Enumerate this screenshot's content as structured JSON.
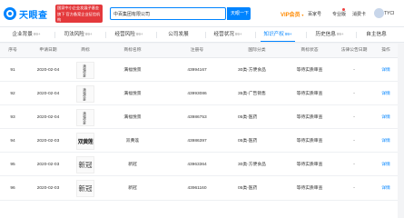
{
  "header": {
    "logo_text": "天眼查",
    "promo_text": "国家中小企业发展子基金旗下 官方备案企业征信机构",
    "search_value": "中百集团有限公司",
    "search_button": "天眼一下",
    "vip_label": "VIP会员",
    "nav": [
      "百家号",
      "专业版",
      "消费卡",
      "TYCI"
    ],
    "user": "TYCI"
  },
  "tabs": [
    {
      "label": "企业背景",
      "count": "99+"
    },
    {
      "label": "司法风险",
      "count": "99+"
    },
    {
      "label": "经营风险",
      "count": "99+"
    },
    {
      "label": "公司发展",
      "count": ""
    },
    {
      "label": "经营状况",
      "count": "99+"
    },
    {
      "label": "知识产权",
      "count": "99+"
    },
    {
      "label": "历史信息",
      "count": "99+"
    },
    {
      "label": "自主信息",
      "count": ""
    }
  ],
  "table": {
    "columns": [
      "序号",
      "申请日期",
      "商标",
      "商标名称",
      "注册号",
      "国际分类",
      "商标状态",
      "法律公告日期",
      "操作"
    ],
    "rows": [
      {
        "index": "91",
        "date": "2020-02-04",
        "mark_style": "tiny",
        "mark_text": "满福悦景",
        "name": "满福悦景",
        "reg_no": "43994167",
        "category": "30类-方便食品",
        "status": "等待实质审查",
        "notice": "-",
        "action": "详情"
      },
      {
        "index": "92",
        "date": "2020-02-04",
        "mark_style": "tiny",
        "mark_text": "满福悦景",
        "name": "满福悦景",
        "reg_no": "43993086",
        "category": "35类-广告销售",
        "status": "等待实质审查",
        "notice": "-",
        "action": "详情"
      },
      {
        "index": "93",
        "date": "2020-02-04",
        "mark_style": "tiny",
        "mark_text": "满福悦景",
        "name": "满福悦景",
        "reg_no": "43986753",
        "category": "05类-医药",
        "status": "等待实质审查",
        "notice": "-",
        "action": "详情"
      },
      {
        "index": "94",
        "date": "2020-02-03",
        "mark_style": "callig",
        "mark_text": "双黄莲",
        "name": "双黄莲",
        "reg_no": "43986397",
        "category": "05类-医药",
        "status": "等待实质审查",
        "notice": "-",
        "action": "详情"
      },
      {
        "index": "95",
        "date": "2020-02-03",
        "mark_style": "serif",
        "mark_text": "新冠",
        "name": "新冠",
        "reg_no": "43963364",
        "category": "30类-方便食品",
        "status": "等待实质审查",
        "notice": "-",
        "action": "详情"
      },
      {
        "index": "96",
        "date": "2020-02-03",
        "mark_style": "serif",
        "mark_text": "新冠",
        "name": "新冠",
        "reg_no": "43961160",
        "category": "05类-医药",
        "status": "等待实质审查",
        "notice": "-",
        "action": "详情"
      }
    ]
  }
}
